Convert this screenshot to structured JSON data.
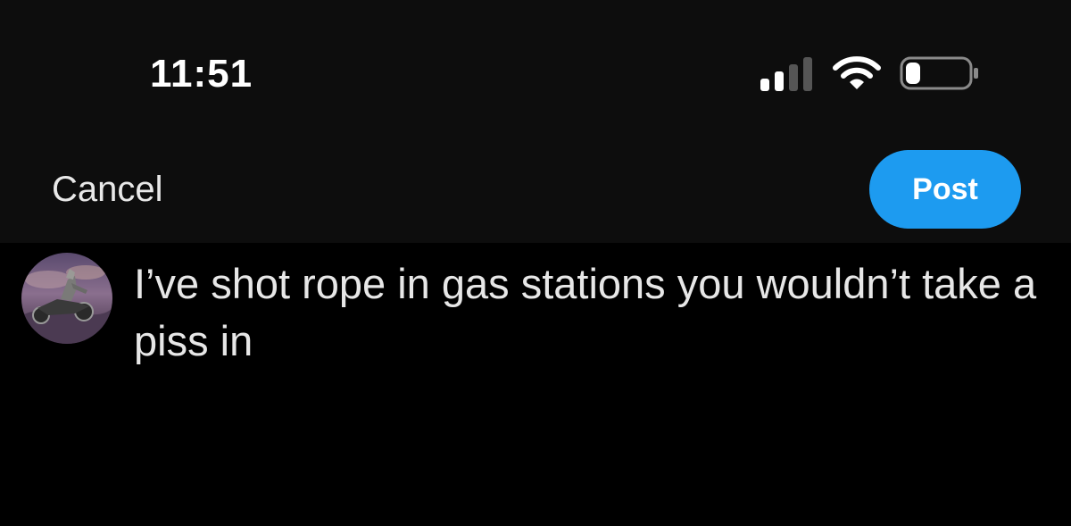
{
  "status_bar": {
    "time": "11:51",
    "signal_icon": "cellular-signal-icon",
    "wifi_icon": "wifi-icon",
    "battery_icon": "battery-icon",
    "signal_bars_active": 2,
    "signal_bars_total": 4,
    "battery_level": 0.2
  },
  "nav": {
    "cancel_label": "Cancel",
    "post_label": "Post"
  },
  "compose": {
    "avatar_icon": "user-avatar",
    "text": "I’ve shot rope in gas stations you wouldn’t take a piss in"
  },
  "colors": {
    "background": "#000000",
    "header_background": "#0d0d0d",
    "accent": "#1d9bf0",
    "text": "#e7e7e7"
  }
}
